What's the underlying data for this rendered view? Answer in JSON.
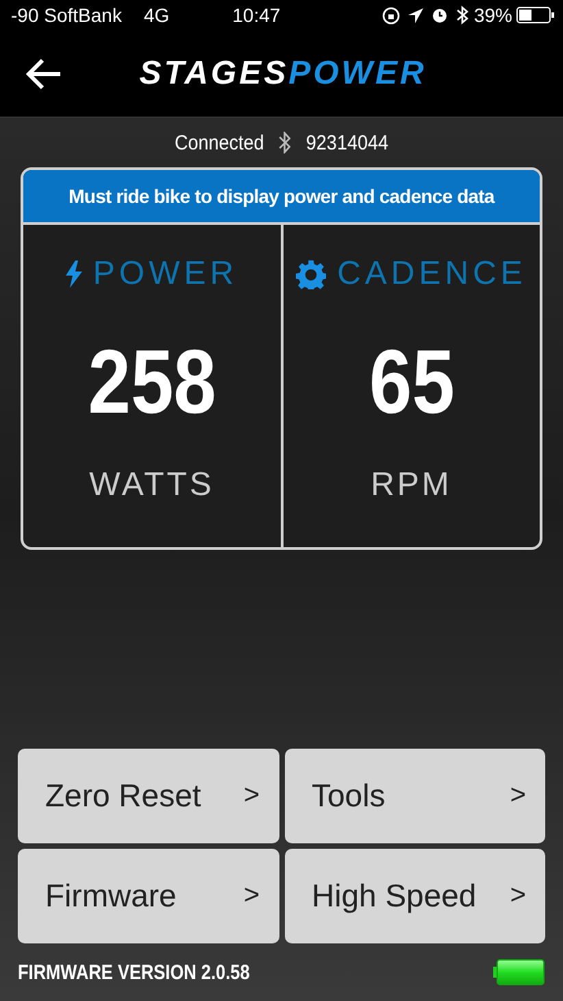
{
  "status_bar": {
    "carrier": "-90 SoftBank",
    "network": "4G",
    "time": "10:47",
    "battery_percent": "39%"
  },
  "header": {
    "logo_primary": "STAGES",
    "logo_accent": "POWER"
  },
  "connection": {
    "status": "Connected",
    "device_id": "92314044"
  },
  "notice": "Must ride bike to display power and cadence data",
  "metrics": [
    {
      "kind": "power",
      "label": "POWER",
      "value": "258",
      "unit": "WATTS"
    },
    {
      "kind": "cadence",
      "label": "CADENCE",
      "value": "65",
      "unit": "RPM"
    }
  ],
  "buttons": [
    {
      "label": "Zero Reset",
      "chevron": ">"
    },
    {
      "label": "Tools",
      "chevron": ">"
    },
    {
      "label": "Firmware",
      "chevron": ">"
    },
    {
      "label": "High Speed",
      "chevron": ">"
    }
  ],
  "footer": {
    "firmware_version": "FIRMWARE VERSION 2.0.58"
  }
}
